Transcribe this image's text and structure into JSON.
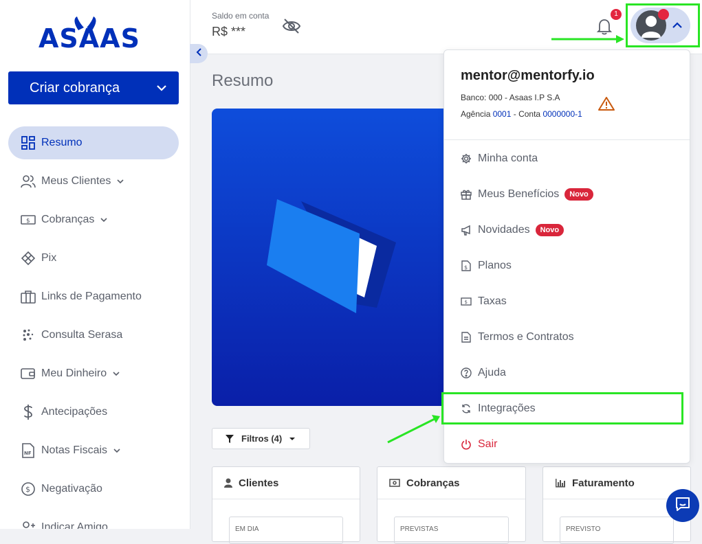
{
  "brand": {
    "logo_text": "ASAAS",
    "accent": "#0030b9"
  },
  "sidebar": {
    "create_button": "Criar cobrança",
    "items": [
      {
        "label": "Resumo",
        "icon": "dashboard-icon",
        "active": true,
        "dropdown": false
      },
      {
        "label": "Meus Clientes",
        "icon": "users-icon",
        "active": false,
        "dropdown": true
      },
      {
        "label": "Cobranças",
        "icon": "money-icon",
        "active": false,
        "dropdown": true
      },
      {
        "label": "Pix",
        "icon": "pix-icon",
        "active": false,
        "dropdown": false
      },
      {
        "label": "Links de Pagamento",
        "icon": "briefcase-icon",
        "active": false,
        "dropdown": false
      },
      {
        "label": "Consulta Serasa",
        "icon": "serasa-icon",
        "active": false,
        "dropdown": false
      },
      {
        "label": "Meu Dinheiro",
        "icon": "wallet-icon",
        "active": false,
        "dropdown": true
      },
      {
        "label": "Antecipações",
        "icon": "dollar-icon",
        "active": false,
        "dropdown": false
      },
      {
        "label": "Notas Fiscais",
        "icon": "invoice-icon",
        "active": false,
        "dropdown": true
      },
      {
        "label": "Negativação",
        "icon": "negativacao-icon",
        "active": false,
        "dropdown": false
      },
      {
        "label": "Indicar Amigo",
        "icon": "add-user-icon",
        "active": false,
        "dropdown": false
      }
    ]
  },
  "header": {
    "balance_label": "Saldo em conta",
    "balance_value": "R$ ***",
    "notification_count": "1"
  },
  "main": {
    "title": "Resumo",
    "filter_label": "Filtros (4)",
    "cards": [
      {
        "title": "Clientes",
        "icon": "user-icon",
        "inner_label": "EM DIA"
      },
      {
        "title": "Cobranças",
        "icon": "money-icon",
        "inner_label": "PREVISTAS"
      },
      {
        "title": "Faturamento",
        "icon": "bar-chart-icon",
        "inner_label": "PREVISTO"
      }
    ]
  },
  "user_menu": {
    "email": "mentor@mentorfy.io",
    "bank": "Banco: 000 - Asaas I.P S.A",
    "agency_prefix": "Agência ",
    "agency": "0001",
    "account_prefix": " - Conta ",
    "account": "0000000-1",
    "items": [
      {
        "label": "Minha conta",
        "icon": "gear-icon",
        "badge": ""
      },
      {
        "label": "Meus Benefícios",
        "icon": "gift-icon",
        "badge": "Novo"
      },
      {
        "label": "Novidades",
        "icon": "megaphone-icon",
        "badge": "Novo"
      },
      {
        "label": "Planos",
        "icon": "document-dollar-icon",
        "badge": ""
      },
      {
        "label": "Taxas",
        "icon": "money-icon",
        "badge": ""
      },
      {
        "label": "Termos e Contratos",
        "icon": "document-icon",
        "badge": ""
      },
      {
        "label": "Ajuda",
        "icon": "help-icon",
        "badge": ""
      },
      {
        "label": "Integrações",
        "icon": "sync-icon",
        "badge": ""
      },
      {
        "label": "Sair",
        "icon": "power-icon",
        "badge": ""
      }
    ]
  },
  "annotation_color": "#29e524"
}
